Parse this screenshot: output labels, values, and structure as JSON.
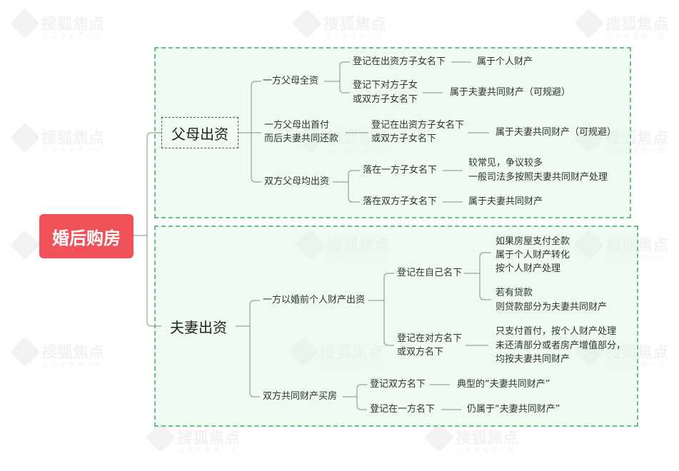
{
  "root": "婚后购房",
  "branches": {
    "parents": {
      "label": "父母出资",
      "one_full": "一方父母全资",
      "one_full_a": "登记在出资方子女名下",
      "one_full_a_res": "属于个人财产",
      "one_full_b1": "登记下对方子女",
      "one_full_b2": "或双方子女名下",
      "one_full_b_res": "属于夫妻共同财产（可规避）",
      "down_1": "一方父母出首付",
      "down_2": "而后夫妻共同还款",
      "down_a1": "登记在出资方子女名下",
      "down_a2": "或双方子女名下",
      "down_res": "属于夫妻共同财产（可规避）",
      "both": "双方父母均出资",
      "both_a": "落在一方子女名下",
      "both_a_res1": "较常见，争议较多",
      "both_a_res2": "一般司法多按照夫妻共同财产处理",
      "both_b": "落在双方子女名下",
      "both_b_res": "属于夫妻共同财产"
    },
    "couple": {
      "label": "夫妻出资",
      "pre": "一方以婚前个人财产出资",
      "pre_a": "登记在自己名下",
      "pre_a_r1": "如果房屋支付全款",
      "pre_a_r2": "属于个人财产转化",
      "pre_a_r3": "按个人财产处理",
      "pre_a_r4": "若有贷款",
      "pre_a_r5": "则贷款部分为夫妻共同财产",
      "pre_b1": "登记在对方名下",
      "pre_b2": "或双方名下",
      "pre_b_r1": "只支付首付，按个人财产处理",
      "pre_b_r2": "未还清部分或者房产增值部分，",
      "pre_b_r3": "均按夫妻共同财产",
      "joint": "双方共同财产买房",
      "joint_a": "登记双方名下",
      "joint_a_res": "典型的“夫妻共同财产”",
      "joint_b": "登记在一方名下",
      "joint_b_res": "仍属于“夫妻共同财产”"
    }
  },
  "watermark": {
    "brand": "搜狐焦点",
    "slogan": "让 买 房 变 得 一 点"
  },
  "colors": {
    "root_bg": "#f1525a",
    "box_border": "#66c08a",
    "box_fill": "#e1f5e8",
    "line": "#8a8a8a"
  }
}
